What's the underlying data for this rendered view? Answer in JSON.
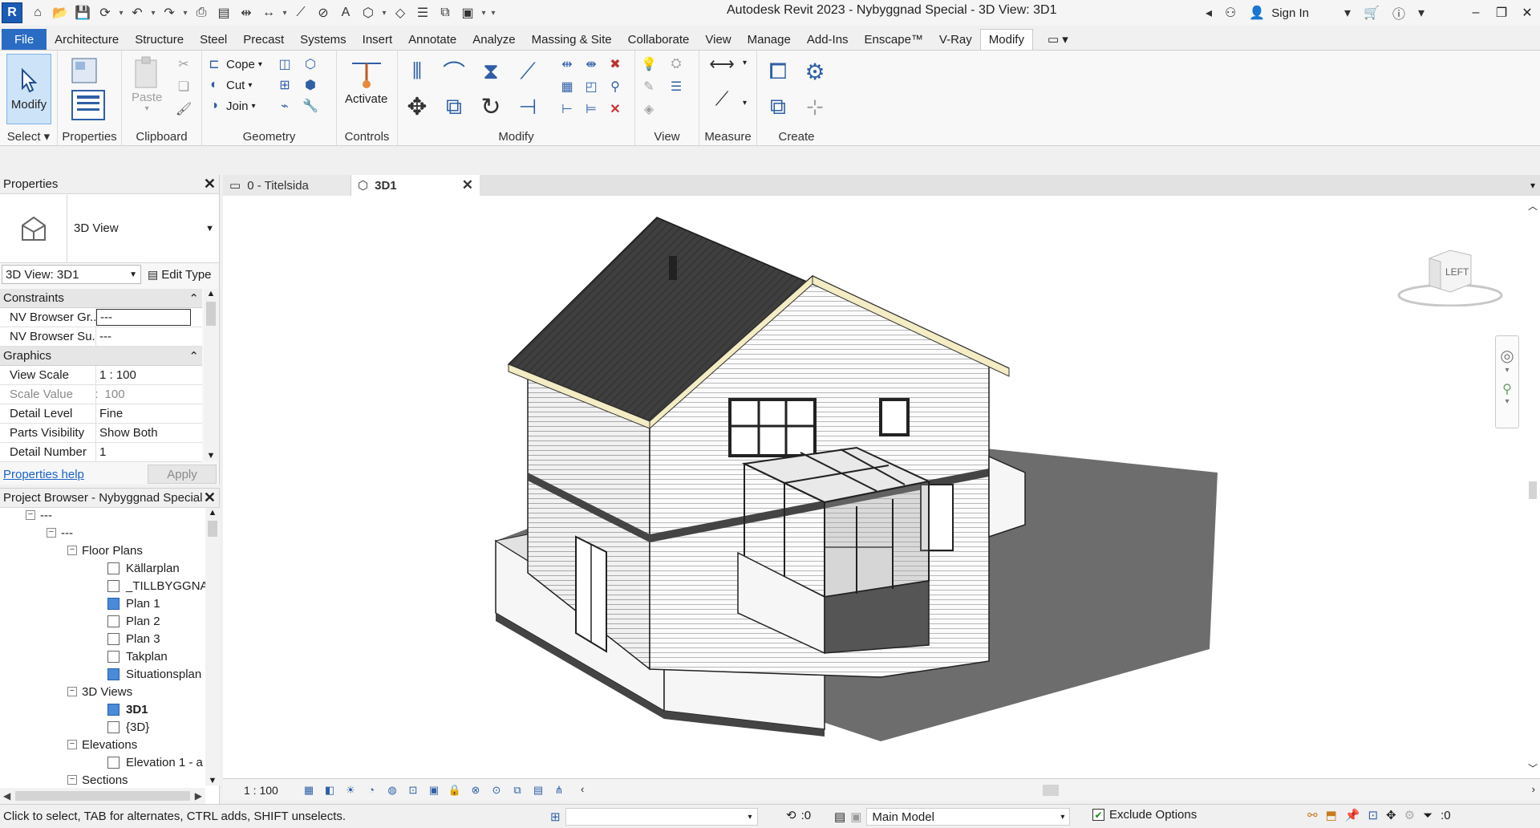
{
  "app": {
    "title": "Autodesk Revit 2023 - Nybyggnad Special - 3D View: 3D1",
    "logo_letter": "R",
    "sign_in": "Sign In"
  },
  "ribbon": {
    "tabs": [
      "File",
      "Architecture",
      "Structure",
      "Steel",
      "Precast",
      "Systems",
      "Insert",
      "Annotate",
      "Analyze",
      "Massing & Site",
      "Collaborate",
      "View",
      "Manage",
      "Add-Ins",
      "Enscape™",
      "V-Ray",
      "Modify"
    ],
    "active_tab": "Modify",
    "panels": {
      "select": "Select",
      "properties": "Properties",
      "clipboard": "Clipboard",
      "geometry": "Geometry",
      "controls": "Controls",
      "modify": "Modify",
      "view": "View",
      "measure": "Measure",
      "create": "Create"
    },
    "buttons": {
      "modify": "Modify",
      "paste": "Paste",
      "cope": "Cope",
      "cut": "Cut",
      "join": "Join",
      "activate": "Activate"
    }
  },
  "properties": {
    "header": "Properties",
    "type_name": "3D View",
    "view_selector": "3D View: 3D1",
    "edit_type": "Edit Type",
    "groups": [
      {
        "name": "Constraints",
        "rows": [
          {
            "name": "NV Browser Gr...",
            "value": "---"
          },
          {
            "name": "NV Browser Su...",
            "value": "---"
          }
        ]
      },
      {
        "name": "Graphics",
        "rows": [
          {
            "name": "View Scale",
            "value": "1 : 100"
          },
          {
            "name": "Scale Value",
            "prefix": "1:",
            "value": "100"
          },
          {
            "name": "Detail Level",
            "value": "Fine"
          },
          {
            "name": "Parts Visibility",
            "value": "Show Both"
          },
          {
            "name": "Detail Number",
            "value": "1"
          }
        ]
      }
    ],
    "help_link": "Properties help",
    "apply": "Apply"
  },
  "project_browser": {
    "header": "Project Browser - Nybyggnad Special",
    "nodes": [
      {
        "label": "---",
        "level": 1,
        "toggle": "-"
      },
      {
        "label": "---",
        "level": 2,
        "toggle": "-"
      },
      {
        "label": "Floor Plans",
        "level": 3,
        "toggle": "-"
      },
      {
        "label": "Källarplan",
        "level": 4,
        "icon": "plain"
      },
      {
        "label": "_TILLBYGGNAD",
        "level": 4,
        "icon": "plain"
      },
      {
        "label": "Plan 1",
        "level": 4,
        "icon": "blue"
      },
      {
        "label": "Plan 2",
        "level": 4,
        "icon": "plain"
      },
      {
        "label": "Plan 3",
        "level": 4,
        "icon": "plain"
      },
      {
        "label": "Takplan",
        "level": 4,
        "icon": "plain"
      },
      {
        "label": "Situationsplan",
        "level": 4,
        "icon": "blue"
      },
      {
        "label": "3D Views",
        "level": 3,
        "toggle": "-"
      },
      {
        "label": "3D1",
        "level": 4,
        "icon": "blue",
        "bold": true
      },
      {
        "label": "{3D}",
        "level": 4,
        "icon": "plain"
      },
      {
        "label": "Elevations",
        "level": 3,
        "toggle": "-"
      },
      {
        "label": "Elevation 1 - a",
        "level": 4,
        "icon": "plain"
      },
      {
        "label": "Sections",
        "level": 3,
        "toggle": "-"
      }
    ]
  },
  "view_tabs": [
    {
      "label": "0 - Titelsida",
      "active": false
    },
    {
      "label": "3D1",
      "active": true
    }
  ],
  "viewcube": {
    "face": "LEFT"
  },
  "view_bar": {
    "scale": "1 : 100"
  },
  "status_bar": {
    "message": "Click to select, TAB for alternates, CTRL adds, SHIFT unselects.",
    "count": ":0",
    "model": "Main Model",
    "exclude_options": "Exclude Options",
    "filter_count": ":0"
  },
  "colors": {
    "file_tab": "#2a6cc4",
    "selection_blue": "#4a8ad8",
    "roof": "#3c3c3c",
    "fascia": "#f3ecc4"
  }
}
